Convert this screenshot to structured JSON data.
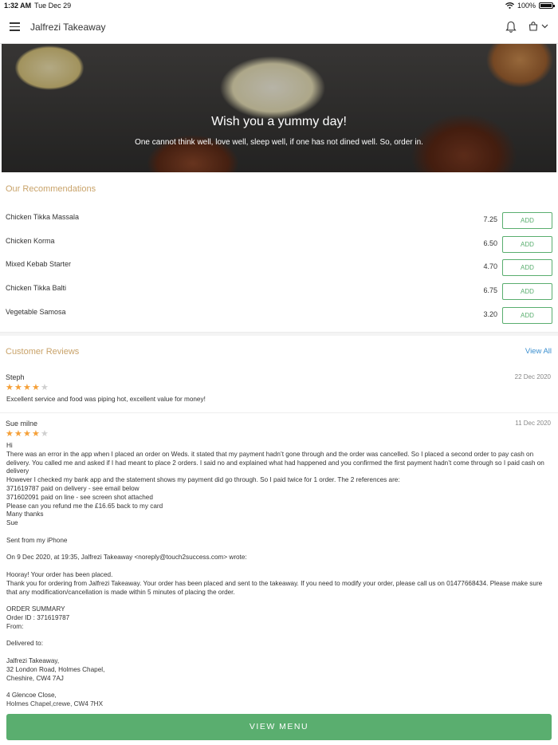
{
  "status_bar": {
    "time": "1:32 AM",
    "date": "Tue Dec 29",
    "battery": "100%"
  },
  "nav": {
    "title": "Jalfrezi Takeaway"
  },
  "hero": {
    "title": "Wish you a yummy day!",
    "subtitle": "One cannot think well, love well, sleep well, if one has not dined well. So, order in."
  },
  "recommendations": {
    "title": "Our Recommendations",
    "add_label": "ADD",
    "items": [
      {
        "name": "Chicken Tikka Massala",
        "price": "7.25"
      },
      {
        "name": "Chicken Korma",
        "price": "6.50"
      },
      {
        "name": "Mixed Kebab Starter",
        "price": "4.70"
      },
      {
        "name": "Chicken Tikka Balti",
        "price": "6.75"
      },
      {
        "name": "Vegetable Samosa",
        "price": "3.20"
      }
    ]
  },
  "reviews": {
    "title": "Customer Reviews",
    "view_all": "View All",
    "items": [
      {
        "name": "Steph",
        "date": "22 Dec 2020",
        "rating": 4,
        "lines": [
          "Excellent service and food was piping hot, excellent value for money!"
        ]
      },
      {
        "name": "Sue milne",
        "date": "11 Dec 2020",
        "rating": 4,
        "lines": [
          "Hi",
          "There was an error in the app when I placed an order on Weds. it stated that my payment hadn’t gone through and the order was cancelled. So I placed a second order to pay cash on delivery. You called me and asked if I had meant to place 2 orders. I said no and explained what had happened and you confirmed the first payment hadn’t come through so I paid cash on delivery",
          "However I checked my bank app and the statement shows my payment did go through. So I paid twice for 1 order. The 2 references are:",
          "371619787 paid on delivery - see email below",
          "371602091 paid on line - see screen shot attached",
          "Please can you refund me the £16.65 back to my card",
          "Many thanks",
          "Sue",
          "",
          "Sent from my iPhone",
          "",
          "On 9 Dec 2020, at 19:35, Jalfrezi Takeaway <noreply@touch2success.com> wrote:",
          "",
          "Hooray! Your order has been placed.",
          "Thank you for ordering from Jalfrezi Takeaway. Your order has been placed and sent to the takeaway. If you need to modify your order, please call us on 01477668434. Please make sure that any modification/cancellation is made within 5 minutes of placing the order.",
          "",
          "ORDER SUMMARY",
          "Order ID : 371619787",
          "From:",
          "",
          "Delivered to:",
          "",
          "Jalfrezi Takeaway,",
          "32 London Road, Holmes Chapel,",
          "Cheshire, CW4 7AJ",
          "",
          "4 Glencoe Close,",
          "Holmes Chapel,crewe, CW4 7HX"
        ]
      }
    ]
  },
  "footer": {
    "view_menu": "VIEW MENU"
  },
  "colors": {
    "accent_green": "#5aae6f",
    "section_gold": "#c9a36a",
    "link_blue": "#3b8fcf",
    "star": "#f5a038"
  }
}
